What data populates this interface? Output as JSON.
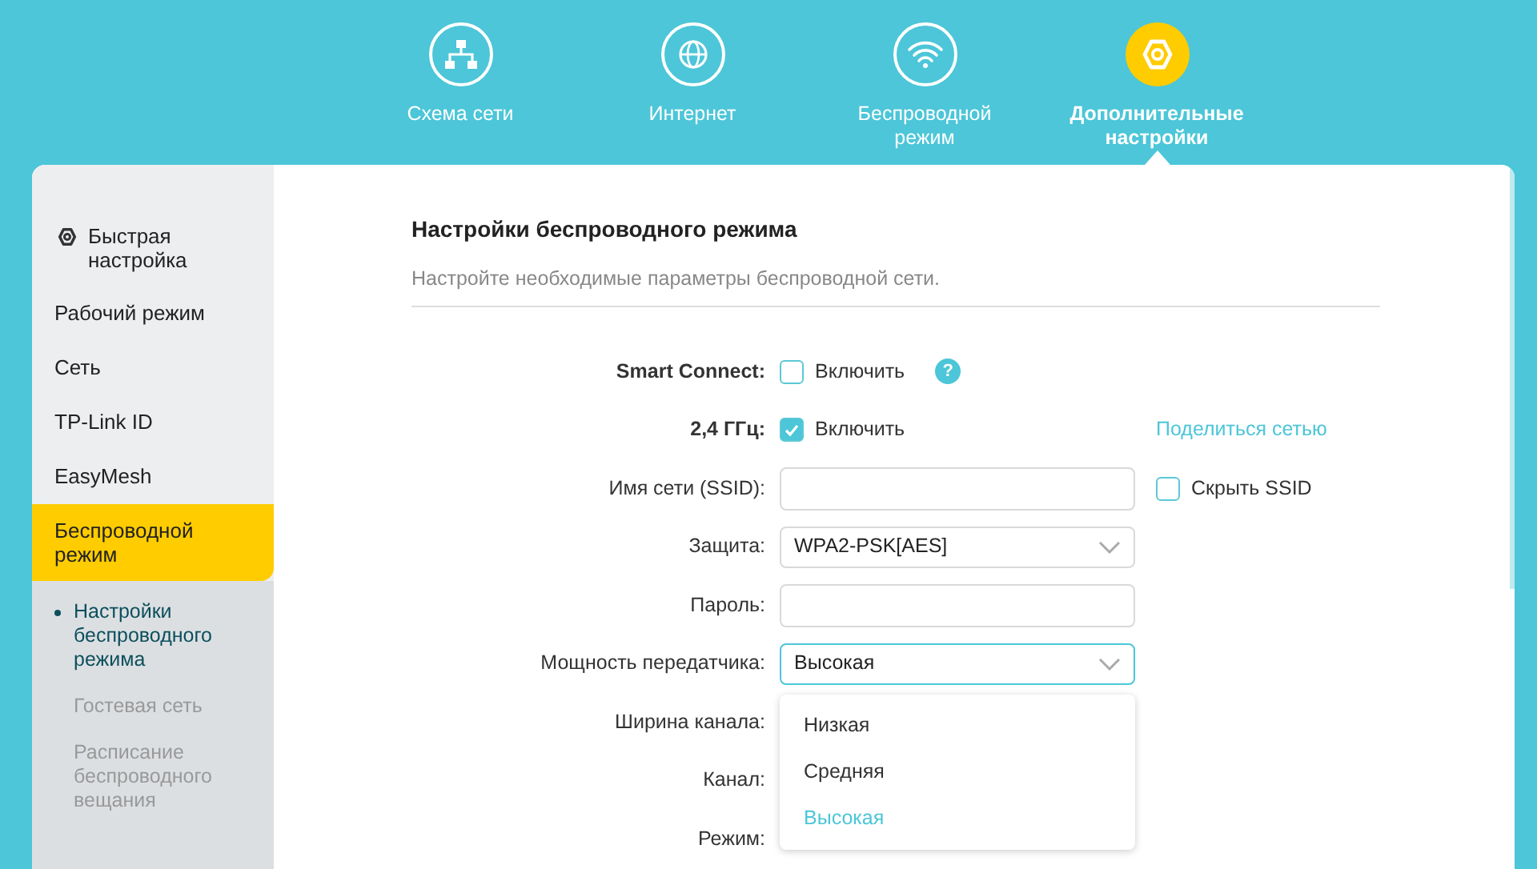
{
  "top_nav": [
    {
      "label": "Схема сети",
      "selected": false
    },
    {
      "label": "Интернет",
      "selected": false
    },
    {
      "label": "Беспроводной режим",
      "selected": false
    },
    {
      "label": "Дополнительные настройки",
      "selected": true
    }
  ],
  "sidebar": {
    "items": [
      {
        "label": "Быстрая настройка",
        "selected": false
      },
      {
        "label": "Рабочий режим",
        "selected": false
      },
      {
        "label": "Сеть",
        "selected": false
      },
      {
        "label": "TP-Link ID",
        "selected": false
      },
      {
        "label": "EasyMesh",
        "selected": false
      },
      {
        "label": "Беспроводной режим",
        "selected": true,
        "children": [
          {
            "label": "Настройки беспроводного режима",
            "selected": true
          },
          {
            "label": "Гостевая сеть",
            "selected": false
          },
          {
            "label": "Расписание беспроводного вещания",
            "selected": false
          }
        ]
      }
    ]
  },
  "section": {
    "title": "Настройки беспроводного режима",
    "subtitle": "Настройте необходимые параметры беспроводной сети."
  },
  "form": [
    {
      "kind": "checkbox",
      "label": "Smart Connect:",
      "bold": true,
      "text": "Включить",
      "checked": false,
      "help": "?"
    },
    {
      "kind": "checkbox",
      "label": "2,4 ГГц:",
      "bold": true,
      "text": "Включить",
      "checked": true,
      "link": "Поделиться сетью"
    },
    {
      "kind": "input",
      "label": "Имя сети (SSID):",
      "side_checkbox": {
        "text": "Скрыть SSID",
        "checked": false
      }
    },
    {
      "kind": "select",
      "label": "Защита:",
      "value": "WPA2-PSK[AES]",
      "focused": false
    },
    {
      "kind": "input",
      "label": "Пароль:"
    },
    {
      "kind": "select",
      "label": "Мощность передатчика:",
      "value": "Высокая",
      "focused": true,
      "options": [
        {
          "label": "Низкая",
          "selected": false
        },
        {
          "label": "Средняя",
          "selected": false
        },
        {
          "label": "Высокая",
          "selected": true
        }
      ]
    },
    {
      "kind": "label",
      "label": "Ширина канала:"
    },
    {
      "kind": "label",
      "label": "Канал:"
    },
    {
      "kind": "label",
      "label": "Режим:"
    }
  ]
}
